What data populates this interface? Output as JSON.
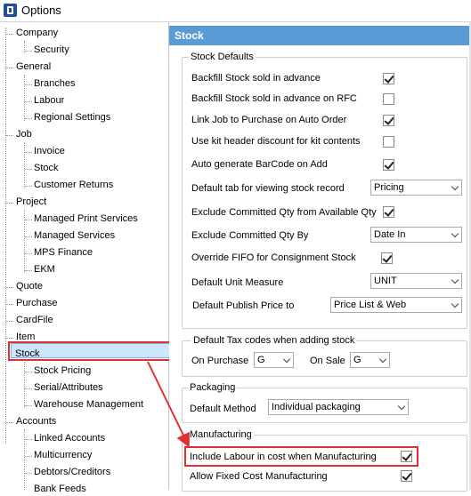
{
  "window": {
    "title": "Options"
  },
  "tree": {
    "company": "Company",
    "security": "Security",
    "general": "General",
    "branches": "Branches",
    "labour": "Labour",
    "regional": "Regional Settings",
    "job": "Job",
    "invoice": "Invoice",
    "job_stock": "Stock",
    "customer_returns": "Customer Returns",
    "project": "Project",
    "managed_print": "Managed Print Services",
    "managed_services": "Managed Services",
    "mps_finance": "MPS Finance",
    "ekm": "EKM",
    "quote": "Quote",
    "purchase": "Purchase",
    "cardfile": "CardFile",
    "item": "Item",
    "stock": "Stock",
    "stock_pricing": "Stock Pricing",
    "serial_attributes": "Serial/Attributes",
    "warehouse": "Warehouse Management",
    "accounts": "Accounts",
    "linked_accounts": "Linked Accounts",
    "multicurrency": "Multicurrency",
    "debtors_creditors": "Debtors/Creditors",
    "bank_feeds": "Bank Feeds"
  },
  "panel": {
    "header": "Stock",
    "stock_defaults": {
      "title": "Stock Defaults",
      "backfill_advance": "Backfill Stock sold in advance",
      "backfill_rfc": "Backfill Stock sold in advance on RFC",
      "link_job": "Link Job to Purchase on Auto Order",
      "kit_header": "Use kit header discount for kit contents",
      "auto_barcode": "Auto generate BarCode on Add",
      "default_tab": "Default tab for viewing stock record",
      "default_tab_value": "Pricing",
      "exclude_committed": "Exclude Committed Qty from Available Qty",
      "exclude_by": "Exclude Committed Qty By",
      "exclude_by_value": "Date In",
      "override_fifo": "Override FIFO for Consignment Stock",
      "default_unit": "Default Unit Measure",
      "default_unit_value": "UNIT",
      "default_publish": "Default Publish Price to",
      "default_publish_value": "Price List & Web"
    },
    "tax": {
      "title": "Default Tax codes when adding stock",
      "on_purchase": "On Purchase",
      "on_purchase_value": "G",
      "on_sale": "On Sale",
      "on_sale_value": "G"
    },
    "packaging": {
      "title": "Packaging",
      "default_method": "Default Method",
      "default_method_value": "Individual packaging"
    },
    "manufacturing": {
      "title": "Manufacturing",
      "include_labour": "Include Labour in cost when Manufacturing",
      "allow_fixed": "Allow Fixed Cost Manufacturing"
    }
  },
  "checks": {
    "backfill_advance": true,
    "backfill_rfc": false,
    "link_job": true,
    "kit_header": false,
    "auto_barcode": true,
    "exclude_committed": true,
    "override_fifo": true,
    "include_labour": true,
    "allow_fixed": true
  },
  "colors": {
    "header_bg": "#5a9bd5",
    "selection_bg": "#cfe5fb",
    "highlight_red": "#e03030"
  }
}
